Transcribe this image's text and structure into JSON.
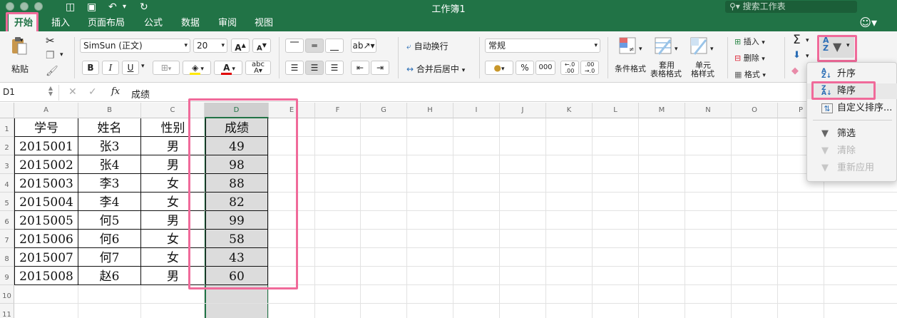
{
  "window": {
    "title": "工作簿1",
    "search_placeholder": "搜索工作表"
  },
  "tabs": [
    {
      "label": "开始",
      "active": true
    },
    {
      "label": "插入"
    },
    {
      "label": "页面布局"
    },
    {
      "label": "公式"
    },
    {
      "label": "数据"
    },
    {
      "label": "审阅"
    },
    {
      "label": "视图"
    }
  ],
  "ribbon": {
    "paste_label": "粘贴",
    "font_name": "SimSun (正文)",
    "font_size": "20",
    "wrap_text_label": "自动换行",
    "merge_center_label": "合并后居中",
    "number_format": "常规",
    "percent_label": "%",
    "comma_label": "000",
    "conditional_format_label": "条件格式",
    "table_format_label_1": "套用",
    "table_format_label_2": "表格格式",
    "cell_style_label_1": "单元",
    "cell_style_label_2": "格样式",
    "insert_label": "插入",
    "delete_label": "删除",
    "format_label": "格式",
    "bold": "B",
    "italic": "I",
    "underline": "U",
    "grow_font": "A",
    "shrink_font": "A"
  },
  "formula_bar": {
    "name_box": "D1",
    "fx": "fx",
    "content": "成绩"
  },
  "grid": {
    "columns": [
      "A",
      "B",
      "C",
      "D",
      "E",
      "F",
      "G",
      "H",
      "I",
      "J",
      "K",
      "L",
      "M",
      "N",
      "O",
      "P"
    ],
    "rows": [
      "1",
      "2",
      "3",
      "4",
      "5",
      "6",
      "7",
      "8",
      "9",
      "10",
      "11"
    ],
    "headers": [
      "学号",
      "姓名",
      "性别",
      "成绩"
    ],
    "records": [
      [
        "2015001",
        "张3",
        "男",
        "49"
      ],
      [
        "2015002",
        "张4",
        "男",
        "98"
      ],
      [
        "2015003",
        "李3",
        "女",
        "88"
      ],
      [
        "2015004",
        "李4",
        "女",
        "82"
      ],
      [
        "2015005",
        "何5",
        "男",
        "99"
      ],
      [
        "2015006",
        "何6",
        "女",
        "58"
      ],
      [
        "2015007",
        "何7",
        "女",
        "43"
      ],
      [
        "2015008",
        "赵6",
        "男",
        "60"
      ]
    ]
  },
  "sort_menu": {
    "ascending": "升序",
    "descending": "降序",
    "custom_sort": "自定义排序...",
    "filter": "筛选",
    "clear": "清除",
    "reapply": "重新应用"
  },
  "colors": {
    "brand_green": "#217346",
    "highlight_pink": "#f06a9a",
    "selection_gray": "#d9d9d9"
  }
}
